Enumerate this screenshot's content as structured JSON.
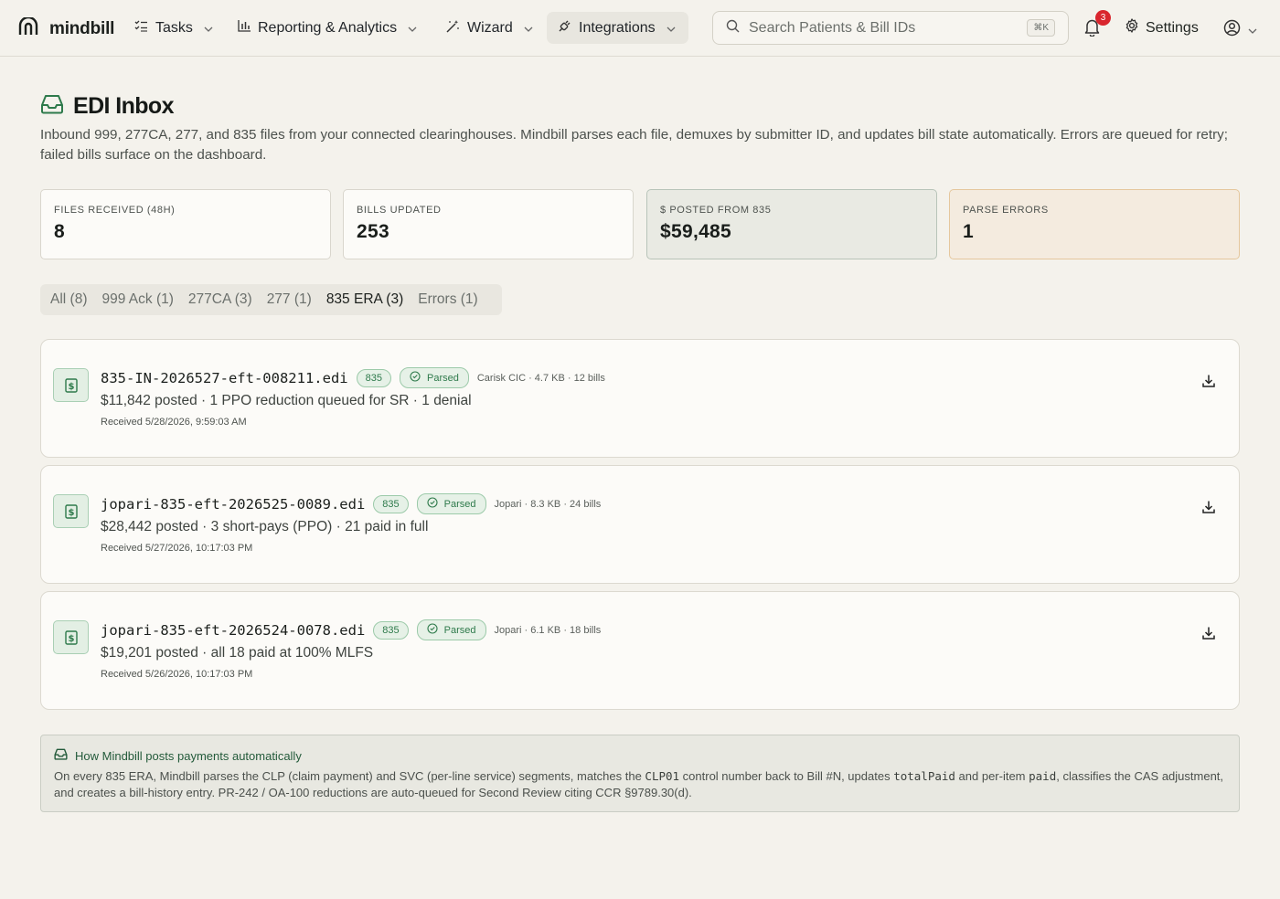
{
  "nav": {
    "brand": "mindbill",
    "items": [
      {
        "label": "Tasks"
      },
      {
        "label": "Reporting & Analytics"
      },
      {
        "label": "Wizard"
      },
      {
        "label": "Integrations"
      }
    ],
    "search_placeholder": "Search Patients & Bill IDs",
    "search_shortcut": "⌘K",
    "notification_count": "3",
    "settings_label": "Settings"
  },
  "page": {
    "title": "EDI Inbox",
    "description": "Inbound 999, 277CA, 277, and 835 files from your connected clearinghouses. Mindbill parses each file, demuxes by submitter ID, and updates bill state automatically. Errors are queued for retry; failed bills surface on the dashboard."
  },
  "stats": [
    {
      "label": "FILES RECEIVED (48H)",
      "value": "8"
    },
    {
      "label": "BILLS UPDATED",
      "value": "253"
    },
    {
      "label": "$ POSTED FROM 835",
      "value": "$59,485"
    },
    {
      "label": "PARSE ERRORS",
      "value": "1"
    }
  ],
  "tabs": [
    {
      "label": "All (8)"
    },
    {
      "label": "999 Ack (1)"
    },
    {
      "label": "277CA (3)"
    },
    {
      "label": "277 (1)"
    },
    {
      "label": "835 ERA (3)"
    },
    {
      "label": "Errors (1)"
    }
  ],
  "active_tab": "835 ERA (3)",
  "files": [
    {
      "name": "835-IN-2026527-eft-008211.edi",
      "type": "835",
      "status": "Parsed",
      "meta": "Carisk CIC · 4.7 KB · 12 bills",
      "summary": "$11,842 posted · 1 PPO reduction queued for SR · 1 denial",
      "received": "Received 5/28/2026, 9:59:03 AM"
    },
    {
      "name": "jopari-835-eft-2026525-0089.edi",
      "type": "835",
      "status": "Parsed",
      "meta": "Jopari · 8.3 KB · 24 bills",
      "summary": "$28,442 posted · 3 short-pays (PPO) · 21 paid in full",
      "received": "Received 5/27/2026, 10:17:03 PM"
    },
    {
      "name": "jopari-835-eft-2026524-0078.edi",
      "type": "835",
      "status": "Parsed",
      "meta": "Jopari · 6.1 KB · 18 bills",
      "summary": "$19,201 posted · all 18 paid at 100% MLFS",
      "received": "Received 5/26/2026, 10:17:03 PM"
    }
  ],
  "info": {
    "title": "How Mindbill posts payments automatically",
    "body_1": "On every 835 ERA, Mindbill parses the CLP (claim payment) and SVC (per-line service) segments, matches the ",
    "code_1": "CLP01",
    "body_2": " control number back to Bill #N, updates ",
    "code_2": "totalPaid",
    "body_3": " and per-item ",
    "code_3": "paid",
    "body_4": ", classifies the CAS adjustment, and creates a bill-history entry. PR-242 / OA-100 reductions are auto-queued for Second Review citing CCR §9789.30(d)."
  },
  "colors": {
    "background": "#f4f2ec",
    "accent_green": "#2e7a4b",
    "badge_red": "#d9262e"
  }
}
